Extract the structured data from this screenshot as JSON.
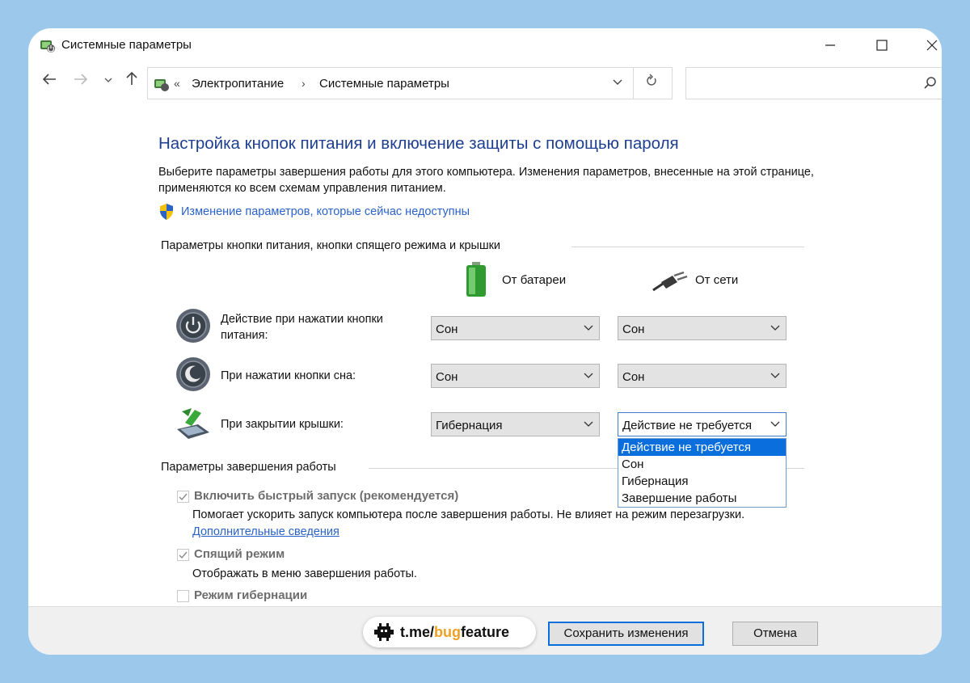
{
  "window": {
    "title": "Системные параметры"
  },
  "window_controls": {
    "minimize": "—",
    "maximize": "☐",
    "close": "✕"
  },
  "address_bar": {
    "prefix": "«",
    "crumbs": [
      "Электропитание",
      "Системные параметры"
    ],
    "separator": "›"
  },
  "search": {
    "placeholder": ""
  },
  "page": {
    "heading": "Настройка кнопок питания и включение защиты с помощью пароля",
    "description": "Выберите параметры завершения работы для этого компьютера. Изменения параметров, внесенные на этой странице, применяются ко всем схемам управления питанием.",
    "unavailable_link": "Изменение параметров, которые сейчас недоступны"
  },
  "buttons_section": {
    "title": "Параметры кнопки питания, кнопки спящего режима и крышки",
    "col_battery": "От батареи",
    "col_ac": "От сети",
    "rows": [
      {
        "label": "Действие при нажатии кнопки питания:",
        "battery": "Сон",
        "ac": "Сон"
      },
      {
        "label": "При нажатии кнопки сна:",
        "battery": "Сон",
        "ac": "Сон"
      },
      {
        "label": "При закрытии крышки:",
        "battery": "Гибернация",
        "ac": "Действие не требуется"
      }
    ],
    "dropdown_options": [
      "Действие не требуется",
      "Сон",
      "Гибернация",
      "Завершение работы"
    ],
    "dropdown_selected": "Действие не требуется"
  },
  "shutdown_section": {
    "title": "Параметры завершения работы",
    "fast_startup": {
      "label": "Включить быстрый запуск (рекомендуется)",
      "checked": true,
      "desc": "Помогает ускорить запуск компьютера после завершения работы. Не влияет на режим перезагрузки.",
      "link": "Дополнительные сведения"
    },
    "sleep": {
      "label": "Спящий режим",
      "checked": true,
      "desc": "Отображать в меню завершения работы."
    },
    "hibernate": {
      "label": "Режим гибернации",
      "checked": false
    }
  },
  "footer": {
    "save": "Сохранить изменения",
    "cancel": "Отмена"
  },
  "watermark": {
    "prefix": "t.me/",
    "highlight": "bug",
    "suffix": "feature"
  },
  "colors": {
    "link": "#2a62c8",
    "heading": "#1e3f8f",
    "selection": "#0a6edc",
    "background": "#9cc8ec"
  }
}
